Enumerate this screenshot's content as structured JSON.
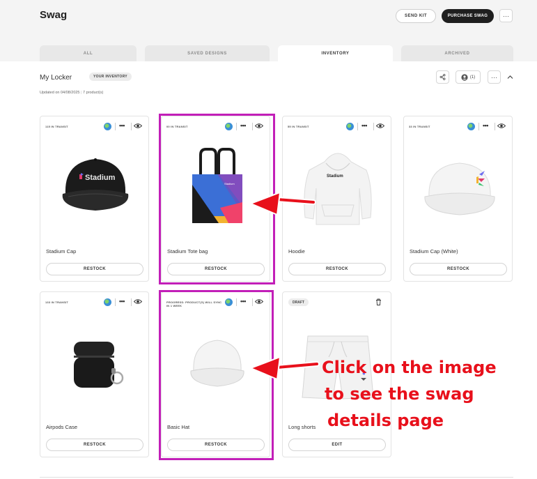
{
  "header": {
    "title": "Swag",
    "send_kit_label": "SEND KIT",
    "purchase_label": "PURCHASE SWAG",
    "more_label": "···"
  },
  "tabs": [
    {
      "label": "ALL"
    },
    {
      "label": "SAVED DESIGNS"
    },
    {
      "label": "INVENTORY"
    },
    {
      "label": "ARCHIVED"
    }
  ],
  "locker": {
    "title": "My Locker",
    "badge": "YOUR INVENTORY",
    "updated": "Updated on 04/08/2025",
    "product_count": "7 product(s)",
    "user_count": "(1)",
    "more_label": "···"
  },
  "cards": [
    {
      "status": "115 IN TRANSIT",
      "name": "Stadium Cap",
      "action": "RESTOCK",
      "image_icon": "black-cap-image"
    },
    {
      "status": "00 IN TRANSIT",
      "name": "Stadium Tote bag",
      "action": "RESTOCK",
      "image_icon": "tote-bag-image"
    },
    {
      "status": "55 IN TRANSIT",
      "name": "Hoodie",
      "action": "RESTOCK",
      "image_icon": "hoodie-image"
    },
    {
      "status": "33 IN TRANSIT",
      "name": "Stadium Cap (White)",
      "action": "RESTOCK",
      "image_icon": "white-cap-image"
    },
    {
      "status": "133 IN TRANSIT",
      "name": "Airpods Case",
      "action": "RESTOCK",
      "image_icon": "airpods-case-image"
    },
    {
      "status": "PROGRESS: PRODUCT(S) WILL SYNC IN 1 WEEK",
      "name": "Basic Hat",
      "action": "RESTOCK",
      "image_icon": "basic-hat-image"
    },
    {
      "status": "DRAFT",
      "name": "Long shorts",
      "action": "EDIT",
      "image_icon": "shorts-image"
    }
  ],
  "logo_text": "Stadium",
  "annotation": {
    "line1": "Click on the image",
    "line2": "to see the swag",
    "line3": "details page"
  },
  "colors": {
    "highlight": "#c21fb8",
    "annotation": "#e8101b",
    "dark_button": "#1f1f1f"
  }
}
